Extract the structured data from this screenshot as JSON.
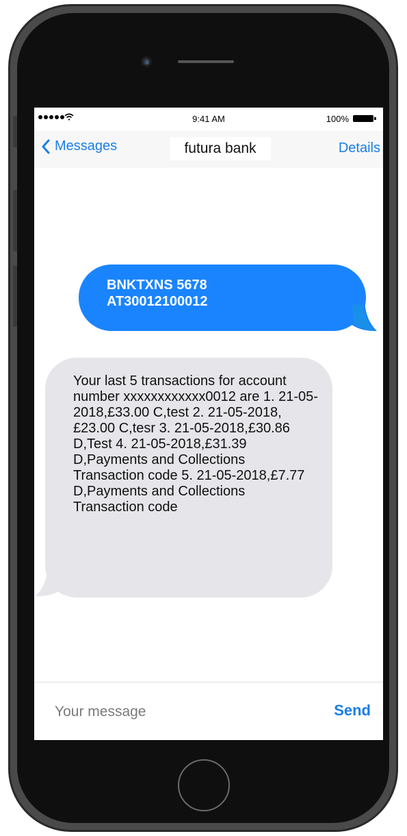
{
  "status_bar": {
    "time": "9:41 AM",
    "battery_percent": "100%",
    "icons": [
      "signal-dots-icon",
      "wifi-icon",
      "battery-icon"
    ]
  },
  "nav": {
    "back_label": "Messages",
    "title": "futura bank",
    "details_label": "Details",
    "back_icon": "chevron-left-icon"
  },
  "conversation": {
    "sent": {
      "line1": "BNKTXNS 5678",
      "line2": "AT30012100012"
    },
    "received": {
      "text": "Your last 5 transactions for account number xxxxxxxxxxxx0012 are 1. 21-05-2018,£33.00 C,test 2. 21-05-2018,£23.00 C,tesr 3. 21-05-2018,£30.86 D,Test 4. 21-05-2018,£31.39 D,Payments and Collections Transaction code 5. 21-05-2018,£7.77 D,Payments and Collections Transaction code"
    }
  },
  "composer": {
    "placeholder": "Your message",
    "value": "",
    "send_label": "Send"
  },
  "colors": {
    "accent": "#1a7ee6",
    "sent_bubble": "#1a84ff",
    "received_bubble": "#e5e5ea",
    "phone_frame": "#0f0f0f"
  }
}
